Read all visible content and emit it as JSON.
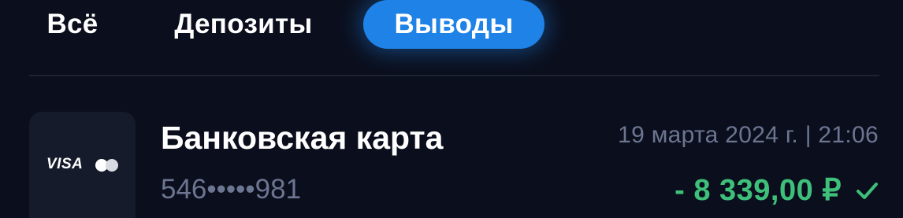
{
  "tabs": {
    "all": "Всё",
    "deposits": "Депозиты",
    "withdrawals": "Выводы",
    "active": "withdrawals"
  },
  "transaction": {
    "method_logo_text": "VISA",
    "method_secondary_icon": "mastercard-icon",
    "title": "Банковская карта",
    "masked_number": "546•••••981",
    "date": "19 марта 2024 г. | 21:06",
    "amount": "- 8 339,00 ₽",
    "status_icon": "check-icon"
  },
  "colors": {
    "background": "#0b0f1d",
    "accent": "#1f82e6",
    "success": "#3ec07a",
    "muted_text": "#6c7591"
  }
}
